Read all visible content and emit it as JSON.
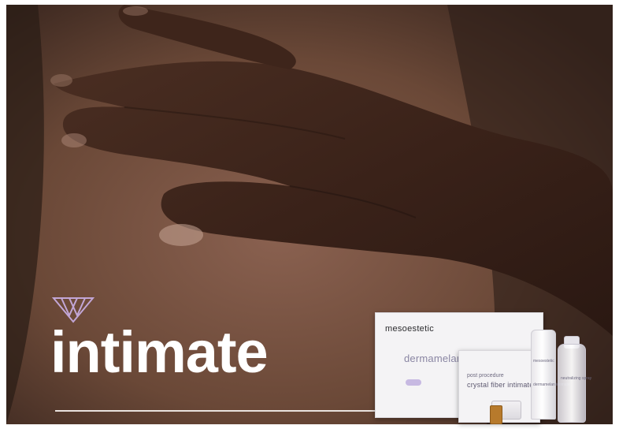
{
  "headline": "intimate",
  "colors": {
    "logo": "#c2a6d6",
    "headline": "#ffffff",
    "rule": "#e9e2de",
    "product_accent": "#8a86a3"
  },
  "products": {
    "brand_main": "mesoestetic",
    "main_name": "dermamelan intim•te",
    "secondary_subtitle": "post procedure",
    "secondary_name": "crystal fiber intimate",
    "tube_brand": "mesoestetic",
    "tube_name": "dermamelan intimate",
    "bottle_name": "neutralizing spray"
  }
}
